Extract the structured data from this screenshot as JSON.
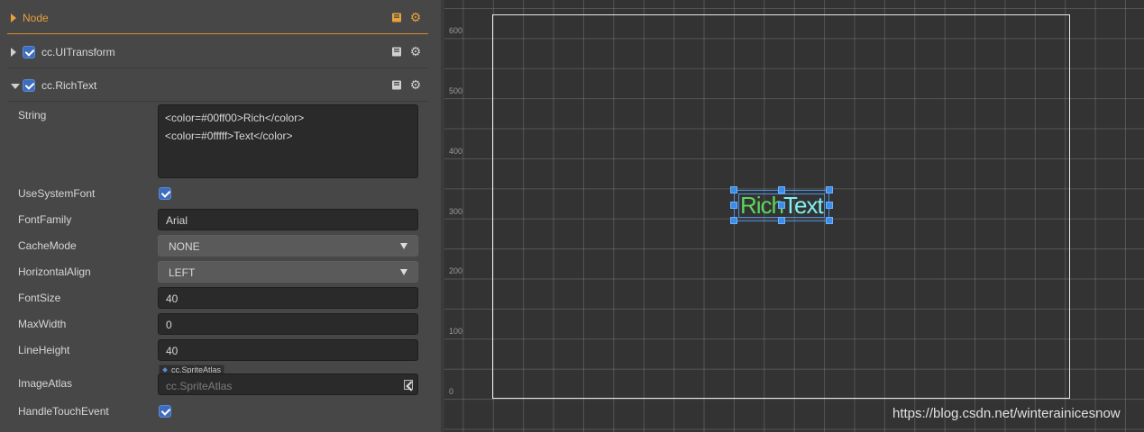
{
  "inspector": {
    "node_header": {
      "title": "Node"
    },
    "components": [
      {
        "title": "cc.UITransform",
        "enabled": true,
        "expanded": false
      },
      {
        "title": "cc.RichText",
        "enabled": true,
        "expanded": true
      }
    ],
    "richtext": {
      "string_label": "String",
      "string_line1": "<color=#00ff00>Rich</color>",
      "string_line2": "<color=#0fffff>Text</color>",
      "use_system_font_label": "UseSystemFont",
      "use_system_font": true,
      "font_family_label": "FontFamily",
      "font_family": "Arial",
      "cache_mode_label": "CacheMode",
      "cache_mode": "NONE",
      "horizontal_align_label": "HorizontalAlign",
      "horizontal_align": "LEFT",
      "font_size_label": "FontSize",
      "font_size": "40",
      "max_width_label": "MaxWidth",
      "max_width": "0",
      "line_height_label": "LineHeight",
      "line_height": "40",
      "image_atlas_label": "ImageAtlas",
      "image_atlas_type_badge": "cc.SpriteAtlas",
      "image_atlas_placeholder": "cc.SpriteAtlas",
      "handle_touch_event_label": "HandleTouchEvent",
      "handle_touch_event": true
    }
  },
  "scene": {
    "y_ruler": [
      "600",
      "500",
      "400",
      "300",
      "200",
      "100",
      "0"
    ],
    "rich_text_part1": "Rich",
    "rich_text_part2": "Text",
    "part1_color": "#00ff00",
    "part2_color": "#0fffff",
    "watermark": "https://blog.csdn.net/winterainicesnow"
  },
  "colors": {
    "accent_orange": "#e8a03a",
    "checkbox_blue": "#3d6dbf",
    "selection_blue": "#4a90e2"
  }
}
